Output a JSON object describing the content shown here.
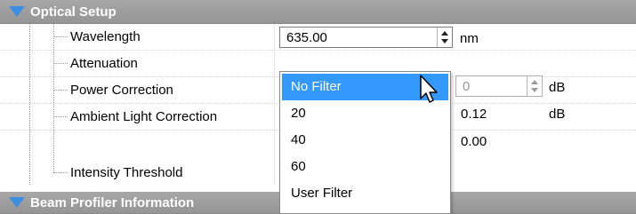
{
  "sections": {
    "optical_setup": "Optical Setup",
    "beam_profiler": "Beam Profiler Information"
  },
  "rows": [
    {
      "label": "Wavelength"
    },
    {
      "label": "Attenuation"
    },
    {
      "label": "Power Correction"
    },
    {
      "label": "Ambient Light Correction"
    },
    {
      "label": "Intensity Threshold"
    }
  ],
  "wavelength": {
    "value": "635.00",
    "unit": "nm"
  },
  "attenuation": {
    "value": "0",
    "unit": "dB"
  },
  "power_correction": {
    "value": "0.12",
    "unit": "dB"
  },
  "ambient_light": {
    "value": "0.00"
  },
  "dropdown": {
    "options": [
      "No Filter",
      "20",
      "40",
      "60",
      "User Filter"
    ],
    "selected": "No Filter"
  },
  "colors": {
    "header": "#9e9e9e",
    "selection": "#3399ff",
    "triangle": "#3c8fe0"
  },
  "icons": {
    "header_toggle": "triangle-down-icon",
    "cursor": "arrow-cursor-icon"
  }
}
